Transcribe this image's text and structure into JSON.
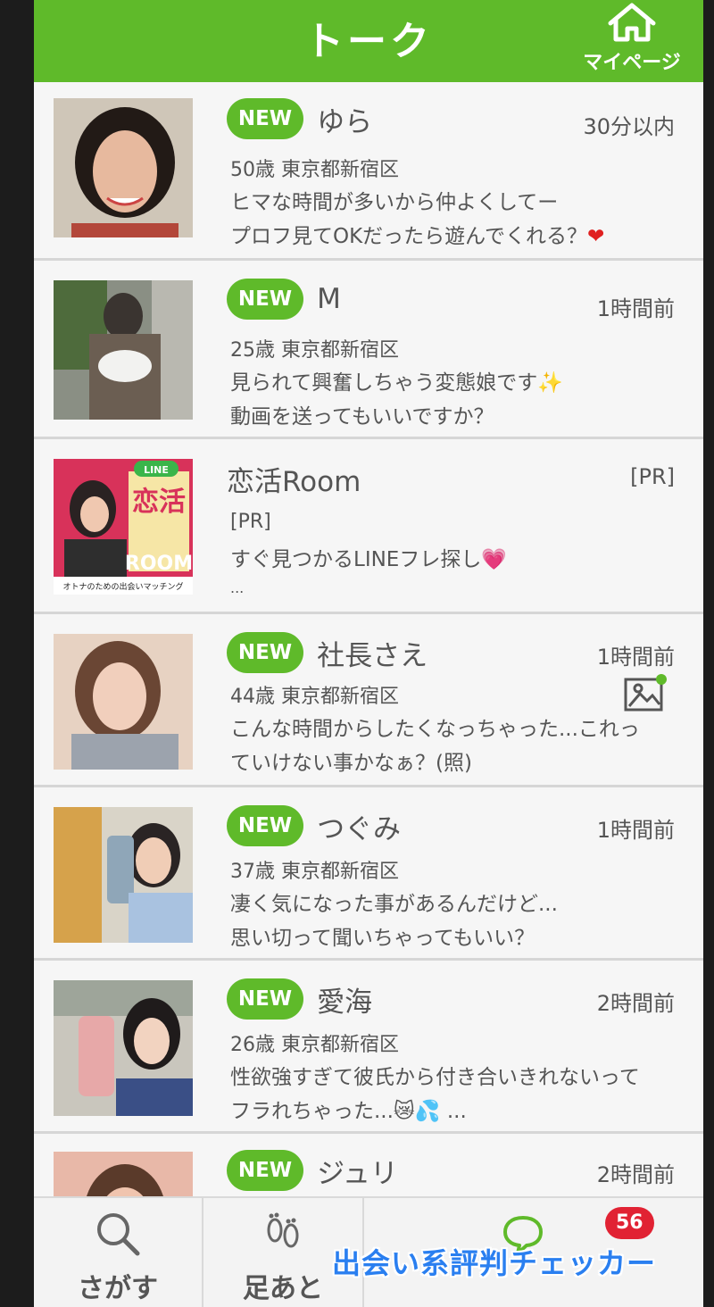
{
  "header": {
    "title": "トーク",
    "mypage_label": "マイページ"
  },
  "badge_new": "NEW",
  "conversations": [
    {
      "name": "ゆら",
      "time": "30分以内",
      "meta": "50歳 東京都新宿区",
      "line1": "ヒマな時間が多いから仲よくしてー",
      "line2": "プロフ見てOKだったら遊んでくれる？",
      "emoji": "❤"
    },
    {
      "name": "M",
      "time": "1時間前",
      "meta": "25歳 東京都新宿区",
      "line1": "見られて興奮しちゃう変態娘です✨",
      "line2": "動画を送ってもいいですか？"
    },
    {
      "name": "恋活Room",
      "time": "[PR]",
      "meta": "[PR]",
      "line1": "すぐ見つかるLINEフレ探し💗",
      "line2": "...",
      "thumb_big_text": "恋活",
      "thumb_room": "ROOM",
      "thumb_line": "LINE",
      "thumb_caption": "オトナのための出会いマッチング"
    },
    {
      "name": "社長さえ",
      "time": "1時間前",
      "meta": "44歳 東京都新宿区",
      "line1": "こんな時間からしたくなっちゃった...これっ",
      "line2": "ていけない事かなぁ？(照)"
    },
    {
      "name": "つぐみ",
      "time": "1時間前",
      "meta": "37歳 東京都新宿区",
      "line1": "凄く気になった事があるんだけど...",
      "line2": "思い切って聞いちゃってもいい？"
    },
    {
      "name": "愛海",
      "time": "2時間前",
      "meta": "26歳 東京都新宿区",
      "line1": "性欲強すぎて彼氏から付き合いきれないって",
      "line2": "フラれちゃった...😿💦 ..."
    },
    {
      "name": "ジュリ",
      "time": "2時間前"
    }
  ],
  "tabs": {
    "search": "さがす",
    "footprints": "足あと",
    "talk_badge": "56"
  },
  "watermark": "出会い系評判チェッカー",
  "colors": {
    "accent": "#5fba2a",
    "badge_red": "#e12233"
  }
}
